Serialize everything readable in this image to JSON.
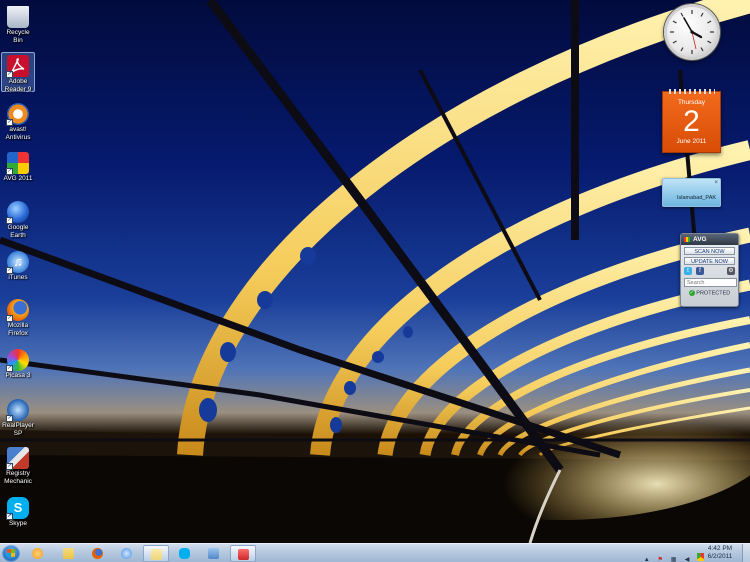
{
  "desktop_icons": [
    {
      "label": "Recycle Bin",
      "icon": "recycle-bin-icon",
      "color": "#cfd8e4"
    },
    {
      "label": "Adobe Reader 9",
      "icon": "adobe-reader-icon",
      "color": "#c8102e",
      "selected": true
    },
    {
      "label": "avast! Antivirus",
      "icon": "avast-icon",
      "color": "#f08a1c"
    },
    {
      "label": "AVG 2011",
      "icon": "avg-icon",
      "color": "#3a9a2a"
    },
    {
      "label": "Google Earth",
      "icon": "google-earth-icon",
      "color": "#2a6ad8"
    },
    {
      "label": "iTunes",
      "icon": "itunes-icon",
      "color": "#4a8fe0"
    },
    {
      "label": "Mozilla Firefox",
      "icon": "firefox-icon",
      "color": "#e66000"
    },
    {
      "label": "Picasa 3",
      "icon": "picasa-icon",
      "color": "#a64cc8"
    },
    {
      "label": "RealPlayer SP",
      "icon": "realplayer-icon",
      "color": "#1e5fb0"
    },
    {
      "label": "Registry Mechanic",
      "icon": "registry-mechanic-icon",
      "color": "#c23b2a"
    },
    {
      "label": "Skype",
      "icon": "skype-icon",
      "color": "#00aff0"
    }
  ],
  "calendar": {
    "day": "Thursday",
    "date": "2",
    "month": "June 2011"
  },
  "network_gadget": {
    "label": "Islamabad_PAK"
  },
  "avg_gadget": {
    "title": "AVG",
    "scan_label": "SCAN NOW",
    "update_label": "UPDATE NOW",
    "search_placeholder": "Search",
    "status": "PROTECTED"
  },
  "taskbar": {
    "apps": [
      {
        "name": "taskbar-media-player",
        "icon": "media-player-icon",
        "color": "#f39b1f",
        "open": false
      },
      {
        "name": "taskbar-explorer",
        "icon": "folder-icon",
        "color": "#e9c24a",
        "open": false
      },
      {
        "name": "taskbar-firefox",
        "icon": "firefox-icon",
        "color": "#e66000",
        "open": false
      },
      {
        "name": "taskbar-itunes",
        "icon": "itunes-icon",
        "color": "#4a8fe0",
        "open": false
      },
      {
        "name": "taskbar-folder-window",
        "icon": "folder-icon",
        "color": "#efd67a",
        "open": true
      },
      {
        "name": "taskbar-skype",
        "icon": "skype-icon",
        "color": "#00aff0",
        "open": false
      },
      {
        "name": "taskbar-remote-desktop",
        "icon": "remote-desktop-icon",
        "color": "#4f86c6",
        "open": false
      },
      {
        "name": "taskbar-snipping-tool",
        "icon": "snipping-tool-icon",
        "color": "#cc2a2a",
        "open": true
      }
    ],
    "clock_time": "4:42 PM",
    "clock_date": "6/2/2011"
  }
}
